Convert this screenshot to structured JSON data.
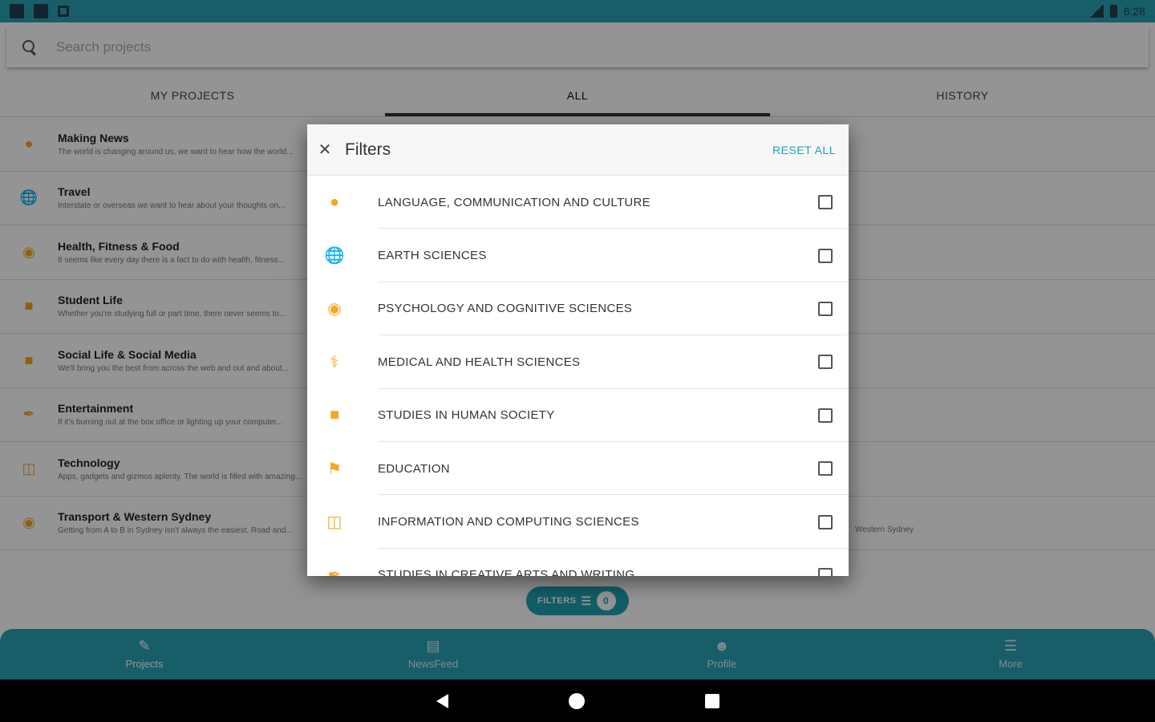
{
  "status_bar": {
    "time": "6:28"
  },
  "search": {
    "placeholder": "Search projects"
  },
  "tabs": [
    {
      "label": "MY PROJECTS",
      "active": false
    },
    {
      "label": "ALL",
      "active": true
    },
    {
      "label": "HISTORY",
      "active": false
    }
  ],
  "projects": [
    {
      "title": "Making News",
      "description": "The world is changing around us, we want to hear how the world...",
      "icon": "chat-bubble-icon"
    },
    {
      "title": "Travel",
      "description": "Interstate or overseas we want to hear about your thoughts on...",
      "icon": "globe-icon"
    },
    {
      "title": "Health, Fitness & Food",
      "description": "It seems like every day there is a fact to do with health, fitness...",
      "icon": "brain-icon"
    },
    {
      "title": "Student Life",
      "description": "Whether you're studying full or part time, there never seems to...",
      "icon": "building-icon"
    },
    {
      "title": "Social Life & Social Media",
      "description": "We'll bring you the best from across the web and out and about...",
      "icon": "building-icon"
    },
    {
      "title": "Entertainment",
      "description": "If it's burning out at the box office or lighting up your computer...",
      "icon": "feather-icon"
    },
    {
      "title": "Technology",
      "description": "Apps, gadgets and gizmos aplenty. The world is filled with amazing...",
      "icon": "devices-icon"
    },
    {
      "title": "Transport & Western Sydney",
      "description": "Getting from A to B in Sydney isn't always the easiest. Road and...",
      "extra": "Western Sydney",
      "icon": "transport-icon"
    }
  ],
  "filters_button": {
    "label": "FILTERS",
    "count": "0"
  },
  "bottom_nav": [
    {
      "label": "Projects",
      "icon": "projects-icon",
      "active": true
    },
    {
      "label": "NewsFeed",
      "icon": "newsfeed-icon",
      "active": false
    },
    {
      "label": "Profile",
      "icon": "profile-icon",
      "active": false
    },
    {
      "label": "More",
      "icon": "menu-icon",
      "active": false
    }
  ],
  "dialog": {
    "title": "Filters",
    "reset_label": "RESET ALL",
    "items": [
      {
        "label": "LANGUAGE, COMMUNICATION AND CULTURE",
        "icon": "chat-bubble-icon",
        "checked": false
      },
      {
        "label": "EARTH SCIENCES",
        "icon": "globe-icon",
        "checked": false
      },
      {
        "label": "PSYCHOLOGY AND COGNITIVE SCIENCES",
        "icon": "brain-icon",
        "checked": false
      },
      {
        "label": "MEDICAL AND HEALTH SCIENCES",
        "icon": "stethoscope-icon",
        "checked": false
      },
      {
        "label": "STUDIES IN HUMAN SOCIETY",
        "icon": "building-icon",
        "checked": false
      },
      {
        "label": "EDUCATION",
        "icon": "graduation-cap-icon",
        "checked": false
      },
      {
        "label": "INFORMATION AND COMPUTING SCIENCES",
        "icon": "devices-icon",
        "checked": false
      },
      {
        "label": "STUDIES IN CREATIVE ARTS AND WRITING",
        "icon": "feather-icon",
        "checked": false
      }
    ]
  },
  "colors": {
    "accent": "#2aa3b4",
    "icon_orange": "#f5a623"
  }
}
